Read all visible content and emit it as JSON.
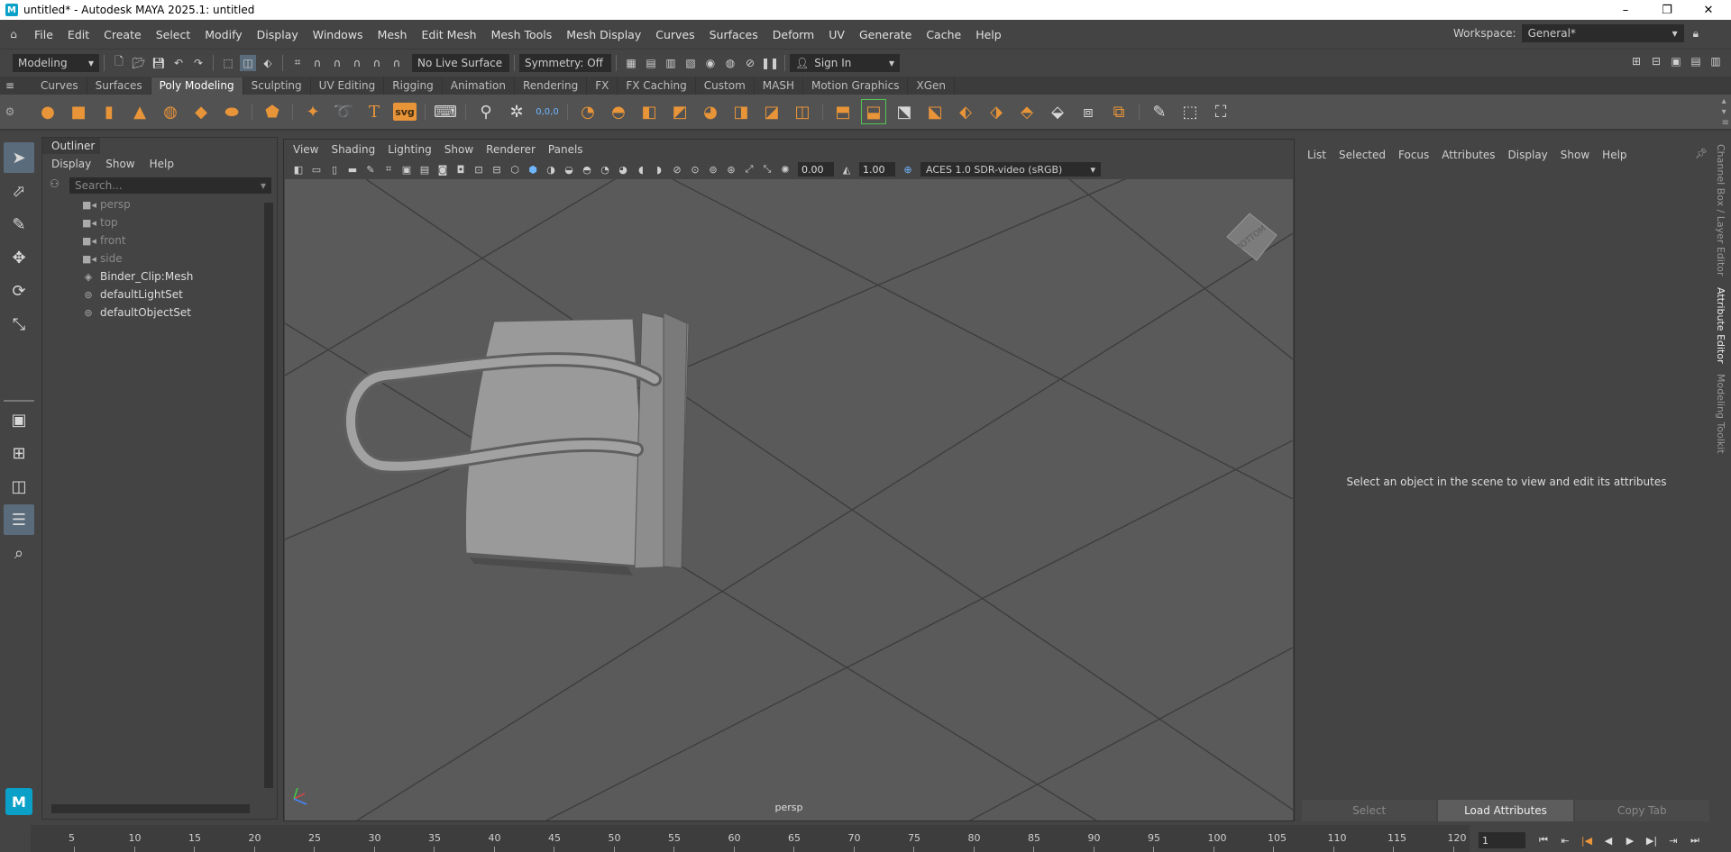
{
  "window": {
    "title": "untitled* - Autodesk MAYA 2025.1: untitled",
    "logo": "M"
  },
  "menubar": {
    "items": [
      "File",
      "Edit",
      "Create",
      "Select",
      "Modify",
      "Display",
      "Windows",
      "Mesh",
      "Edit Mesh",
      "Mesh Tools",
      "Mesh Display",
      "Curves",
      "Surfaces",
      "Deform",
      "UV",
      "Generate",
      "Cache",
      "Help"
    ],
    "workspace_label": "Workspace:",
    "workspace_value": "General*"
  },
  "statusline": {
    "mode": "Modeling",
    "live_surface": "No Live Surface",
    "symmetry": "Symmetry: Off",
    "sign_in": "Sign In"
  },
  "shelf": {
    "tabs": [
      "Curves",
      "Surfaces",
      "Poly Modeling",
      "Sculpting",
      "UV Editing",
      "Rigging",
      "Animation",
      "Rendering",
      "FX",
      "FX Caching",
      "Custom",
      "MASH",
      "Motion Graphics",
      "XGen"
    ],
    "active_tab": "Poly Modeling",
    "text_icon": "T",
    "svg_icon": "svg",
    "coord_icon": "0,0,0"
  },
  "outliner": {
    "title": "Outliner",
    "menus": [
      "Display",
      "Show",
      "Help"
    ],
    "search_placeholder": "Search...",
    "items": [
      {
        "label": "persp",
        "icon": "camera-icon",
        "dim": true
      },
      {
        "label": "top",
        "icon": "camera-icon",
        "dim": true
      },
      {
        "label": "front",
        "icon": "camera-icon",
        "dim": true
      },
      {
        "label": "side",
        "icon": "camera-icon",
        "dim": true
      },
      {
        "label": "Binder_Clip:Mesh",
        "icon": "mesh-icon",
        "dim": false
      },
      {
        "label": "defaultLightSet",
        "icon": "set-icon",
        "dim": false
      },
      {
        "label": "defaultObjectSet",
        "icon": "set-icon",
        "dim": false
      }
    ]
  },
  "viewport": {
    "menus": [
      "View",
      "Shading",
      "Lighting",
      "Show",
      "Renderer",
      "Panels"
    ],
    "exposure": "0.00",
    "gamma": "1.00",
    "color_space": "ACES 1.0 SDR-video (sRGB)",
    "camera": "persp",
    "viewcube_label": "BOTTOM"
  },
  "attribute_editor": {
    "menus": [
      "List",
      "Selected",
      "Focus",
      "Attributes",
      "Display",
      "Show",
      "Help"
    ],
    "message": "Select an object in the scene to view and edit its attributes",
    "buttons": [
      "Select",
      "Load Attributes",
      "Copy Tab"
    ]
  },
  "side_tabs": [
    "Channel Box / Layer Editor",
    "Attribute Editor",
    "Modeling Toolkit"
  ],
  "timeline": {
    "ticks": [
      "5",
      "10",
      "15",
      "20",
      "25",
      "30",
      "35",
      "40",
      "45",
      "50",
      "55",
      "60",
      "65",
      "70",
      "75",
      "80",
      "85",
      "90",
      "95",
      "100",
      "105",
      "110",
      "115",
      "120"
    ],
    "current_frame": "1"
  },
  "colors": {
    "accent_orange": "#e89438",
    "panel": "#444444",
    "viewport_bg": "#5a5a5a",
    "selection_blue": "#5a6c7c"
  }
}
